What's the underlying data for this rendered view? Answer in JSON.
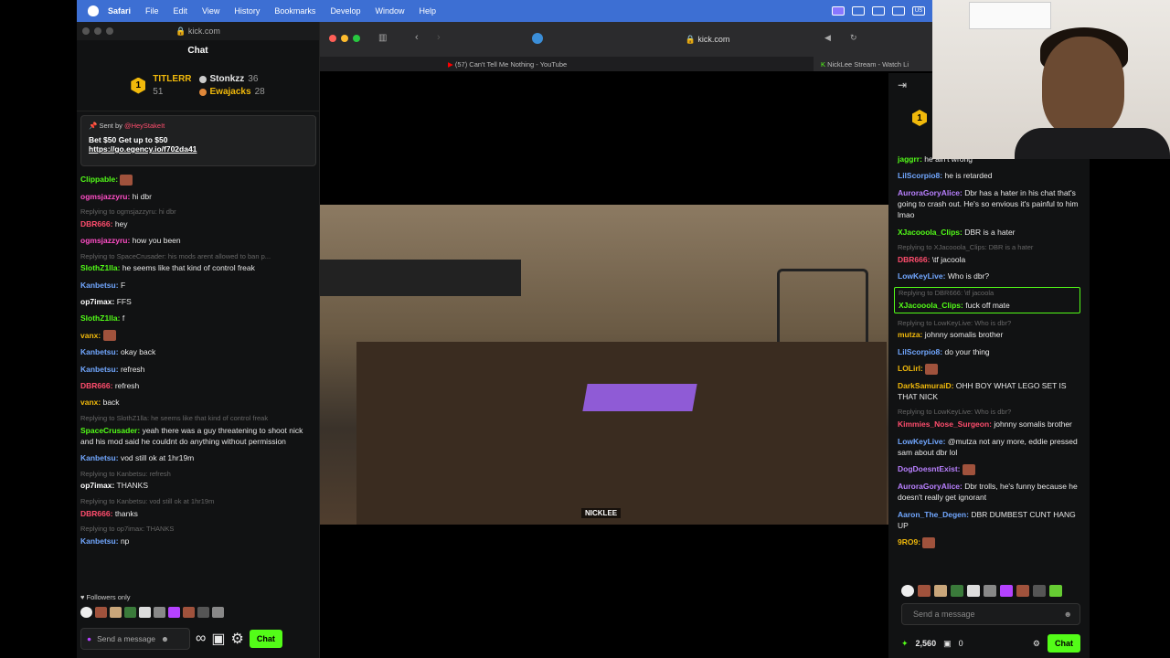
{
  "menubar": {
    "app": "Safari",
    "items": [
      "File",
      "Edit",
      "View",
      "History",
      "Bookmarks",
      "Develop",
      "Window",
      "Help"
    ],
    "status_icon": "US"
  },
  "left_window": {
    "url": "kick.com",
    "title": "Chat",
    "leaderboard": {
      "first": {
        "rank": "1",
        "name": "TITLERR",
        "value": "51"
      },
      "second": {
        "name": "Stonkzz",
        "value": "36"
      },
      "third": {
        "name": "Ewajacks",
        "value": "28"
      }
    },
    "pinned": {
      "sent_by_label": "Sent by",
      "sender": "@HeyStakeIt",
      "message": "Bet $50 Get up to $50",
      "link": "https://go.egency.io/f702da41"
    },
    "messages": [
      {
        "reply": "",
        "user": "Clippable:",
        "color": "#53fc18",
        "text": "",
        "emote": true
      },
      {
        "reply": "",
        "user": "ogmsjazzyru:",
        "color": "#ff4dc6",
        "text": "hi dbr"
      },
      {
        "reply": "Replying to ogmsjazzyru: hi dbr",
        "user": "DBR666:",
        "color": "#ff4d6d",
        "text": "hey"
      },
      {
        "reply": "",
        "user": "ogmsjazzyru:",
        "color": "#ff4dc6",
        "text": "how you been"
      },
      {
        "reply": "Replying to SpaceCrusader: his mods arent allowed to ban p...",
        "user": "SlothZ1lla:",
        "color": "#53fc18",
        "text": "he seems like that kind of control freak"
      },
      {
        "reply": "",
        "user": "Kanbetsu:",
        "color": "#71a7ff",
        "text": "F"
      },
      {
        "reply": "",
        "user": "op7imax:",
        "color": "#fff",
        "text": "FFS"
      },
      {
        "reply": "",
        "user": "SlothZ1lla:",
        "color": "#53fc18",
        "text": "f"
      },
      {
        "reply": "",
        "user": "vanx:",
        "color": "#f1b90b",
        "text": "",
        "emote": true
      },
      {
        "reply": "",
        "user": "Kanbetsu:",
        "color": "#71a7ff",
        "text": "okay back"
      },
      {
        "reply": "",
        "user": "Kanbetsu:",
        "color": "#71a7ff",
        "text": "refresh"
      },
      {
        "reply": "",
        "user": "DBR666:",
        "color": "#ff4d6d",
        "text": "refresh"
      },
      {
        "reply": "",
        "user": "vanx:",
        "color": "#f1b90b",
        "text": "back"
      },
      {
        "reply": "Replying to SlothZ1lla: he seems like that kind of control freak",
        "user": "SpaceCrusader:",
        "color": "#53fc18",
        "text": "yeah there was a guy threatening to shoot nick and his mod said he couldnt do anything without permission"
      },
      {
        "reply": "",
        "user": "Kanbetsu:",
        "color": "#71a7ff",
        "text": "vod still ok at 1hr19m"
      },
      {
        "reply": "Replying to Kanbetsu: refresh",
        "user": "op7imax:",
        "color": "#fff",
        "text": "THANKS"
      },
      {
        "reply": "Replying to Kanbetsu: vod still ok at 1hr19m",
        "user": "DBR666:",
        "color": "#ff4d6d",
        "text": "thanks"
      },
      {
        "reply": "Replying to op7imax: THANKS",
        "user": "Kanbetsu:",
        "color": "#71a7ff",
        "text": "np"
      }
    ],
    "followers_only": "Followers only",
    "send_placeholder": "Send a message",
    "chat_button": "Chat"
  },
  "browser": {
    "url": "kick.com",
    "tab1": "(57) Can't Tell Me Nothing - YouTube",
    "tab2": "NickLee Stream - Watch Li",
    "video_tag": "NICKLEE"
  },
  "right_chat": {
    "messages": [
      {
        "reply": "",
        "user": "jaggrr:",
        "color": "#53fc18",
        "text": "he ain't wrong"
      },
      {
        "reply": "",
        "user": "LilScorpio8:",
        "color": "#71a7ff",
        "text": "he is retarded"
      },
      {
        "reply": "",
        "user": "AuroraGoryAlice:",
        "color": "#b980ff",
        "text": "Dbr has a hater in his chat that's going to crash out. He's so envious it's painful to him lmao"
      },
      {
        "reply": "",
        "user": "XJacooola_Clips:",
        "color": "#53fc18",
        "text": "DBR is a hater"
      },
      {
        "reply": "Replying to XJacooola_Clips: DBR is a hater",
        "user": "DBR666:",
        "color": "#ff4d6d",
        "text": "\\tf jacoola"
      },
      {
        "reply": "",
        "user": "LowKeyLive:",
        "color": "#71a7ff",
        "text": "Who is dbr?"
      },
      {
        "reply": "Replying to DBR666: \\tf jacoola",
        "user": "XJacooola_Clips:",
        "color": "#53fc18",
        "text": "fuck off mate",
        "highlight": true
      },
      {
        "reply": "Replying to LowKeyLive: Who is dbr?",
        "user": "mutza:",
        "color": "#f1b90b",
        "text": "johnny somalis brother"
      },
      {
        "reply": "",
        "user": "LilScorpio8:",
        "color": "#71a7ff",
        "text": "do your thing"
      },
      {
        "reply": "",
        "user": "LOLirl:",
        "color": "#f1b90b",
        "text": "",
        "emote": true
      },
      {
        "reply": "",
        "user": "DarkSamuraiD:",
        "color": "#f1b90b",
        "text": "OHH BOY WHAT LEGO SET IS THAT NICK"
      },
      {
        "reply": "Replying to LowKeyLive: Who is dbr?",
        "user": "Kimmies_Nose_Surgeon:",
        "color": "#ff4d6d",
        "text": "johnny somalis brother"
      },
      {
        "reply": "",
        "user": "LowKeyLive:",
        "color": "#71a7ff",
        "text": "@mutza not any more, eddie pressed sam about dbr lol"
      },
      {
        "reply": "",
        "user": "DogDoesntExist:",
        "color": "#b980ff",
        "text": "",
        "emote": true
      },
      {
        "reply": "",
        "user": "AuroraGoryAlice:",
        "color": "#b980ff",
        "text": "Dbr trolls, he's funny because he doesn't really get ignorant"
      },
      {
        "reply": "",
        "user": "Aaron_The_Degen:",
        "color": "#71a7ff",
        "text": "DBR DUMBEST CUNT HANG UP"
      },
      {
        "reply": "",
        "user": "9RO9:",
        "color": "#f1b90b",
        "text": "",
        "emote": true
      }
    ],
    "send_placeholder": "Send a message",
    "points": "2,560",
    "gifts": "0",
    "chat_button": "Chat",
    "rank": "1"
  }
}
